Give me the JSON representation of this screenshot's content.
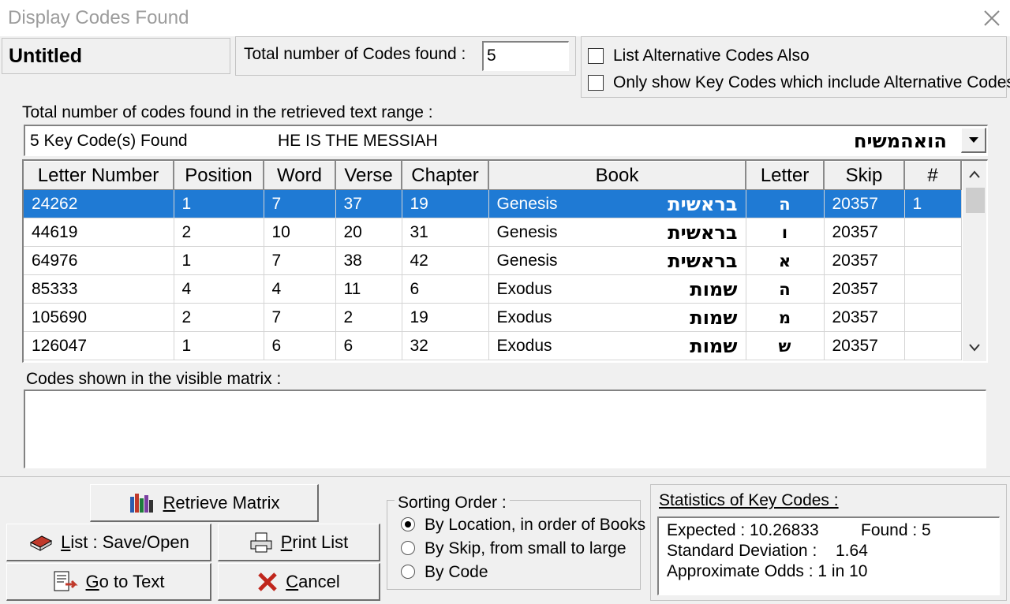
{
  "window": {
    "title": "Display Codes Found"
  },
  "header": {
    "document_name": "Untitled",
    "total_codes_label": "Total number of Codes found :",
    "total_codes_value": "5",
    "checkbox_alt": "List Alternative Codes Also",
    "checkbox_key": "Only show Key Codes which include Alternative Codes"
  },
  "range": {
    "label": "Total number of codes found in the retrieved text range  :",
    "selected_count": "5 Key Code(s) Found",
    "selected_phrase": "HE IS THE MESSIAH",
    "selected_hebrew": "הואהמשיח"
  },
  "table": {
    "columns": [
      "Letter Number",
      "Position",
      "Word",
      "Verse",
      "Chapter",
      "Book",
      "Letter",
      "Skip",
      "#"
    ],
    "rows": [
      {
        "letter_number": "24262",
        "position": "1",
        "word": "7",
        "verse": "37",
        "chapter": "19",
        "book": "Genesis",
        "book_hebrew": "בראשית",
        "letter": "ה",
        "skip": "20357",
        "num": "1"
      },
      {
        "letter_number": "44619",
        "position": "2",
        "word": "10",
        "verse": "20",
        "chapter": "31",
        "book": "Genesis",
        "book_hebrew": "בראשית",
        "letter": "ו",
        "skip": "20357",
        "num": ""
      },
      {
        "letter_number": "64976",
        "position": "1",
        "word": "7",
        "verse": "38",
        "chapter": "42",
        "book": "Genesis",
        "book_hebrew": "בראשית",
        "letter": "א",
        "skip": "20357",
        "num": ""
      },
      {
        "letter_number": "85333",
        "position": "4",
        "word": "4",
        "verse": "11",
        "chapter": "6",
        "book": "Exodus",
        "book_hebrew": "שמות",
        "letter": "ה",
        "skip": "20357",
        "num": ""
      },
      {
        "letter_number": "105690",
        "position": "2",
        "word": "7",
        "verse": "2",
        "chapter": "19",
        "book": "Exodus",
        "book_hebrew": "שמות",
        "letter": "מ",
        "skip": "20357",
        "num": ""
      },
      {
        "letter_number": "126047",
        "position": "1",
        "word": "6",
        "verse": "6",
        "chapter": "32",
        "book": "Exodus",
        "book_hebrew": "שמות",
        "letter": "ש",
        "skip": "20357",
        "num": ""
      }
    ],
    "selected_color": "#1f7ad4"
  },
  "matrix": {
    "label": "Codes shown in the visible matrix :"
  },
  "buttons": {
    "retrieve_hot": "R",
    "retrieve_rest": "etrieve Matrix",
    "list_hot": "L",
    "list_rest": "ist : Save/Open",
    "print_hot": "P",
    "print_rest": "rint List",
    "goto_hot": "G",
    "goto_rest": "o to Text",
    "cancel_hot": "C",
    "cancel_rest": "ancel"
  },
  "sorting": {
    "label": "Sorting Order :",
    "options": [
      "By Location, in order of Books",
      "By Skip, from small to large",
      "By Code"
    ],
    "selected_index": 0
  },
  "statistics": {
    "label": "Statistics of Key Codes :",
    "expected": "Expected :  10.26833",
    "found": "Found : 5",
    "std_dev_label": "Standard Deviation :",
    "std_dev_value": "1.64",
    "odds": "Approximate Odds : 1 in 10"
  }
}
